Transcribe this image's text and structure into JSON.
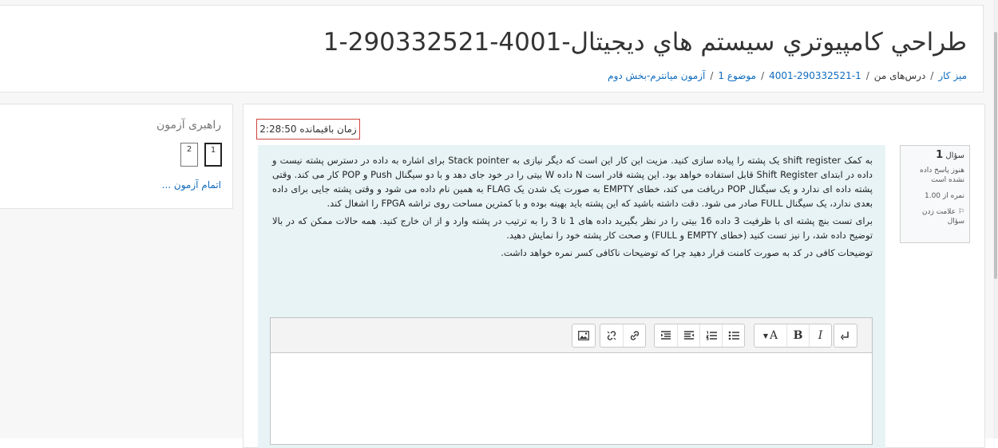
{
  "page": {
    "title": "طراحي کامپيوتري سيستم هاي ديجيتال-4001-290332521-1",
    "breadcrumb": [
      "میز کار",
      "درس‌های من",
      "1-290332521-4001",
      "موضوع 1",
      "آزمون میانترم-بخش دوم"
    ]
  },
  "navigation": {
    "title": "راهبری آزمون",
    "buttons": [
      "1",
      "2"
    ],
    "finish": "اتمام آزمون ..."
  },
  "timer": {
    "text": "زمان باقیمانده 2:28:50"
  },
  "question": {
    "number_label": "سؤال",
    "number": "1",
    "status": "هنوز پاسخ داده نشده است",
    "grade": "نمره از 1.00",
    "flag": "علامت زدن سؤال",
    "paragraphs": [
      "به کمک shift register یک پشته را پیاده سازی کنید. مزیت این کار این است که دیگر نیازی به Stack pointer برای اشاره به داده در دسترس پشته نیست و داده در ابتدای Shift Register قابل استفاده خواهد بود. این پشته قادر است N داده W بیتی را در خود جای دهد و با دو سیگنال Push و POP کار می کند. وقتی پشته داده ای ندارد و یک سیگنال POP دریافت می کند، خطای EMPTY به صورت یک شدن یک FLAG به همین نام داده می شود و وقتی پشته جایی برای داده بعدی ندارد، یک سیگنال FULL صادر می شود. دقت داشته باشید که این پشته باید بهینه بوده و با کمترین مساحت روی تراشه FPGA را اشغال کند.",
      "برای تست بنچ پشته ای با ظرفیت 3 داده 16 بیتی را در نظر بگیرید داده های 1 تا 3 را به ترتیب در پشته وارد و از ان خارج کنید. همه حالات ممکن که در بالا توضیح داده شد، را نیز تست کنید (خطای EMPTY و FULL) و صحت کار پشته خود را نمایش دهید.",
      "توضیحات کافی در کد به صورت کامنت قرار دهید چرا که توضیحات ناکافی کسر نمره خواهد داشت."
    ]
  },
  "editor": {
    "font_button": "A",
    "bold": "B",
    "italic": "I",
    "icons": [
      "collapse-icon",
      "font-color-icon",
      "bold-icon",
      "italic-icon",
      "bullet-list-icon",
      "numbered-list-icon",
      "outdent-icon",
      "indent-icon",
      "link-icon",
      "unlink-icon",
      "image-icon"
    ]
  },
  "colors": {
    "link": "#0f6cbf",
    "question_bg": "#e7f3f5",
    "timer_border": "#d0433b"
  }
}
